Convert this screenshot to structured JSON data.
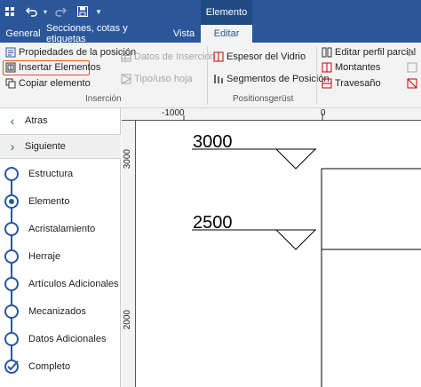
{
  "titlebar": {
    "context_tab_title": "Elemento",
    "qat_icons": [
      "app-grid-icon",
      "undo-icon",
      "redo-icon",
      "save-icon",
      "qat-menu-icon"
    ]
  },
  "tabs": [
    {
      "label": "General",
      "active": false
    },
    {
      "label": "Secciones, cotas y etiquetas",
      "active": false
    },
    {
      "label": "Vista",
      "active": false
    },
    {
      "label": "Editar",
      "active": true
    }
  ],
  "ribbon": {
    "insercion": {
      "group_label": "Inserción",
      "propiedades": "Propiedades de la posición",
      "insertar": "Insertar Elementos",
      "copiar": "Copiar elemento",
      "datos": "Datos de Inserción",
      "tipo": "Tipo/uso hoja"
    },
    "positionsgerust": {
      "group_label": "Positionsgerüst",
      "espesor": "Espesor del Vidrio",
      "segmentos": "Segmentos de Posición"
    },
    "perfil": {
      "editar": "Editar perfil parcial",
      "montantes": "Montantes",
      "travesano": "Travesaño"
    }
  },
  "sidebar": {
    "nav": [
      {
        "label": "Atras",
        "icon": "chevron-left-icon"
      },
      {
        "label": "Siguiente",
        "icon": "chevron-right-icon"
      }
    ],
    "steps": [
      {
        "label": "Estructura",
        "state": "pending"
      },
      {
        "label": "Elemento",
        "state": "current"
      },
      {
        "label": "Acristalamiento",
        "state": "pending"
      },
      {
        "label": "Herraje",
        "state": "pending"
      },
      {
        "label": "Artículos Adicionales",
        "state": "pending"
      },
      {
        "label": "Mecanizados",
        "state": "pending"
      },
      {
        "label": "Datos Adicionales",
        "state": "pending"
      },
      {
        "label": "Completo",
        "state": "done"
      }
    ]
  },
  "drawing": {
    "ruler_top": [
      "-1000",
      "0"
    ],
    "ruler_left": [
      "3000",
      "2000"
    ],
    "elevations": [
      "3000",
      "2500"
    ]
  },
  "colors": {
    "brand": "#2b579a",
    "highlight": "#e0532a"
  }
}
